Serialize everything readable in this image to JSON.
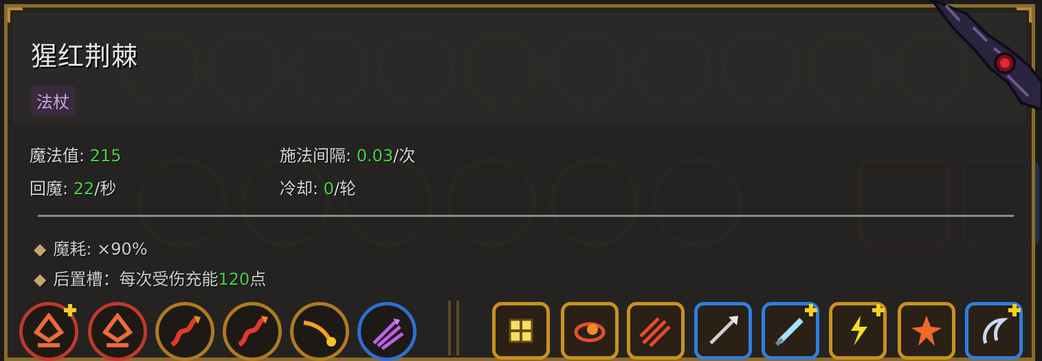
{
  "item": {
    "name": "猩红荆棘",
    "type_tag": "法杖"
  },
  "stats": {
    "mana": {
      "label": "魔法值: ",
      "value": "215"
    },
    "regen": {
      "label": "回魔: ",
      "value": "22",
      "unit": "/秒"
    },
    "cast_interval": {
      "label": "施法间隔: ",
      "value": "0.03",
      "unit": "/次"
    },
    "cooldown": {
      "label": "冷却: ",
      "value": "0",
      "unit": "/轮"
    }
  },
  "bullets": [
    {
      "text": "魔耗: ×90%"
    },
    {
      "prefix": "后置槽：每次受伤充能",
      "value": "120",
      "suffix": "点"
    }
  ],
  "skills": [
    {
      "icon": "flame-diamond-icon",
      "frame": "circle-red",
      "plus": true
    },
    {
      "icon": "flame-diamond-icon",
      "frame": "circle-red",
      "plus": false
    },
    {
      "icon": "split-arrow-icon",
      "frame": "circle-gold",
      "plus": false
    },
    {
      "icon": "split-arrow-icon",
      "frame": "circle-gold",
      "plus": false
    },
    {
      "icon": "comet-trail-icon",
      "frame": "circle-gold",
      "plus": false
    },
    {
      "icon": "purple-wave-icon",
      "frame": "circle-blue",
      "plus": false
    },
    {
      "icon": "golden-grid-icon",
      "frame": "square-gold",
      "plus": false
    },
    {
      "icon": "fire-orbit-icon",
      "frame": "square-gold",
      "plus": false
    },
    {
      "icon": "triple-fire-arrow-icon",
      "frame": "square-gold",
      "plus": false
    },
    {
      "icon": "spear-icon",
      "frame": "square-blue",
      "plus": false
    },
    {
      "icon": "ice-sword-icon",
      "frame": "square-blue",
      "plus": true
    },
    {
      "icon": "lightning-icon",
      "frame": "square-gold",
      "plus": true
    },
    {
      "icon": "fire-burst-icon",
      "frame": "square-gold",
      "plus": false
    },
    {
      "icon": "hook-blade-icon",
      "frame": "square-blue",
      "plus": true
    }
  ],
  "colors": {
    "value_green": "#4ad24a",
    "frame_gold": "#c9921e",
    "frame_blue": "#2f7fe0",
    "frame_red": "#c0392b"
  }
}
